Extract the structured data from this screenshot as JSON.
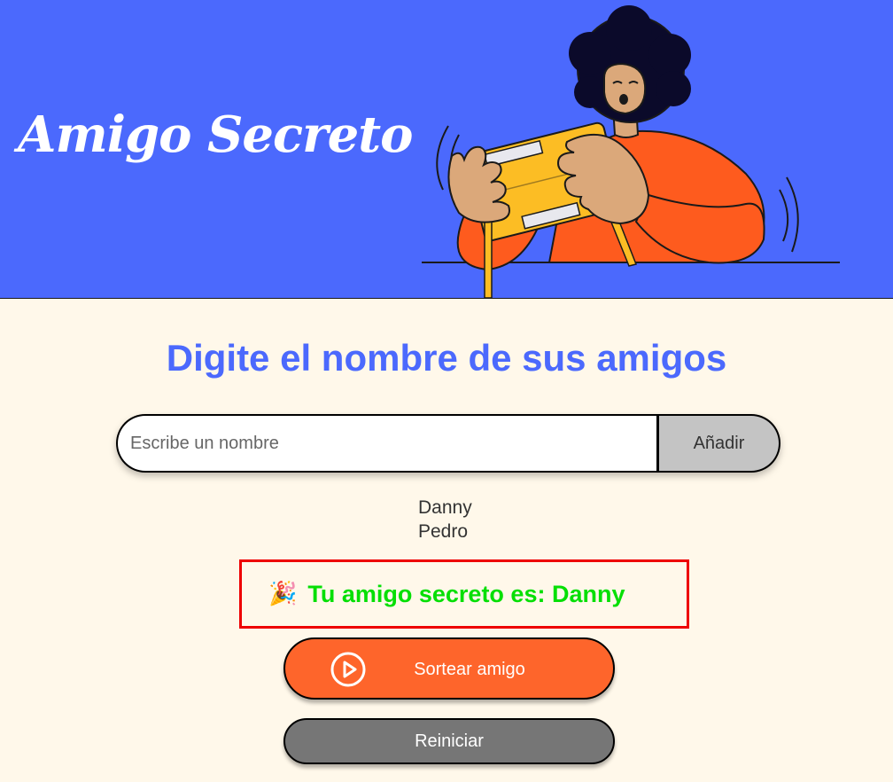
{
  "header": {
    "title": "Amigo Secreto",
    "background_color": "#4b69fd"
  },
  "main": {
    "heading": "Digite el nombre de sus amigos",
    "input": {
      "placeholder": "Escribe un nombre",
      "value": ""
    },
    "add_button_label": "Añadir",
    "friends": [
      "Danny",
      "Pedro"
    ],
    "result": {
      "icon": "party-popper-icon",
      "text": "Tu amigo secreto es: Danny",
      "color": "#05df05",
      "border_color": "#ee0000"
    },
    "draw_button": {
      "label": "Sortear amigo",
      "icon": "play-circle-icon",
      "color": "#fe652b"
    },
    "reset_button": {
      "label": "Reiniciar",
      "color": "#767676"
    },
    "page_background": "#fff8ea",
    "accent_color": "#4b69fd"
  }
}
